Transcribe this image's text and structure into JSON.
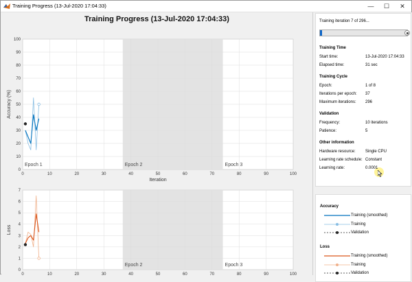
{
  "window": {
    "title": "Training Progress (13-Jul-2020 17:04:33)",
    "controls": {
      "minimize": "—",
      "maximize": "☐",
      "close": "✕"
    }
  },
  "main_title": "Training Progress (13-Jul-2020 17:04:33)",
  "colors": {
    "accuracy": "#0072bd",
    "accuracy_light": "#87bde3",
    "loss": "#d95319",
    "loss_light": "#f0b08a",
    "validation": "#222222",
    "epoch_shade": "#e3e3e3",
    "progress": "#0a64c8"
  },
  "status": {
    "iteration_text": "Training iteration 7 of 296...",
    "progress_fraction": 0.0236
  },
  "info": {
    "training_time": {
      "heading": "Training Time",
      "rows": [
        {
          "label": "Start time:",
          "value": "13-Jul-2020 17:04:33"
        },
        {
          "label": "Elapsed time:",
          "value": "31 sec"
        }
      ]
    },
    "training_cycle": {
      "heading": "Training Cycle",
      "rows": [
        {
          "label": "Epoch:",
          "value": "1 of 8"
        },
        {
          "label": "Iterations per epoch:",
          "value": "37"
        },
        {
          "label": "Maximum iterations:",
          "value": "296"
        }
      ]
    },
    "validation": {
      "heading": "Validation",
      "rows": [
        {
          "label": "Frequency:",
          "value": "10 iterations"
        },
        {
          "label": "Patience:",
          "value": "5"
        }
      ]
    },
    "other": {
      "heading": "Other information",
      "rows": [
        {
          "label": "Hardware resource:",
          "value": "Single CPU"
        },
        {
          "label": "Learning rate schedule:",
          "value": "Constant"
        },
        {
          "label": "Learning rate:",
          "value": "0.0001"
        }
      ]
    }
  },
  "legend": {
    "accuracy": {
      "heading": "Accuracy",
      "items": [
        "Training (smoothed)",
        "Training",
        "Validation"
      ]
    },
    "loss": {
      "heading": "Loss",
      "items": [
        "Training (smoothed)",
        "Training",
        "Validation"
      ]
    }
  },
  "chart_data": [
    {
      "type": "line",
      "title": "",
      "xlabel": "Iteration",
      "ylabel": "Accuracy (%)",
      "xlim": [
        0,
        100
      ],
      "ylim": [
        0,
        100
      ],
      "xticks": [
        0,
        10,
        20,
        30,
        40,
        50,
        60,
        70,
        80,
        90,
        100
      ],
      "yticks": [
        0,
        10,
        20,
        30,
        40,
        50,
        60,
        70,
        80,
        90,
        100
      ],
      "epochs": [
        {
          "label": "Epoch 1",
          "start": 0,
          "end": 37
        },
        {
          "label": "Epoch 2",
          "start": 37,
          "end": 74
        },
        {
          "label": "Epoch 3",
          "start": 74,
          "end": 100
        }
      ],
      "series": [
        {
          "name": "Training (smoothed)",
          "x": [
            1,
            2,
            3,
            4,
            5,
            6
          ],
          "y": [
            30,
            25,
            20,
            42,
            30,
            39
          ]
        },
        {
          "name": "Training",
          "x": [
            1,
            2,
            3,
            4,
            5,
            6
          ],
          "y": [
            30,
            20,
            15,
            55,
            15,
            50
          ]
        },
        {
          "name": "Validation",
          "x": [
            1
          ],
          "y": [
            35
          ]
        }
      ],
      "final_training_marker": {
        "x": 6,
        "y": 50
      }
    },
    {
      "type": "line",
      "title": "",
      "xlabel": "Iteration",
      "ylabel": "Loss",
      "xlim": [
        0,
        100
      ],
      "ylim": [
        0,
        7
      ],
      "xticks": [
        0,
        10,
        20,
        30,
        40,
        50,
        60,
        70,
        80,
        90,
        100
      ],
      "yticks": [
        0,
        1,
        2,
        3,
        4,
        5,
        6,
        7
      ],
      "epochs": [
        {
          "label": "Epoch 2",
          "start": 37,
          "end": 74
        },
        {
          "label": "Epoch 3",
          "start": 74,
          "end": 100
        }
      ],
      "series": [
        {
          "name": "Training (smoothed)",
          "x": [
            1,
            2,
            3,
            4,
            5,
            6
          ],
          "y": [
            2.3,
            2.8,
            3.0,
            2.6,
            4.9,
            3.3
          ]
        },
        {
          "name": "Training",
          "x": [
            1,
            2,
            3,
            4,
            5,
            6
          ],
          "y": [
            2.3,
            3.3,
            3.1,
            2.0,
            6.5,
            1.0
          ]
        },
        {
          "name": "Validation",
          "x": [
            1
          ],
          "y": [
            2.2
          ]
        }
      ],
      "final_training_marker": {
        "x": 6,
        "y": 1.0
      }
    }
  ]
}
